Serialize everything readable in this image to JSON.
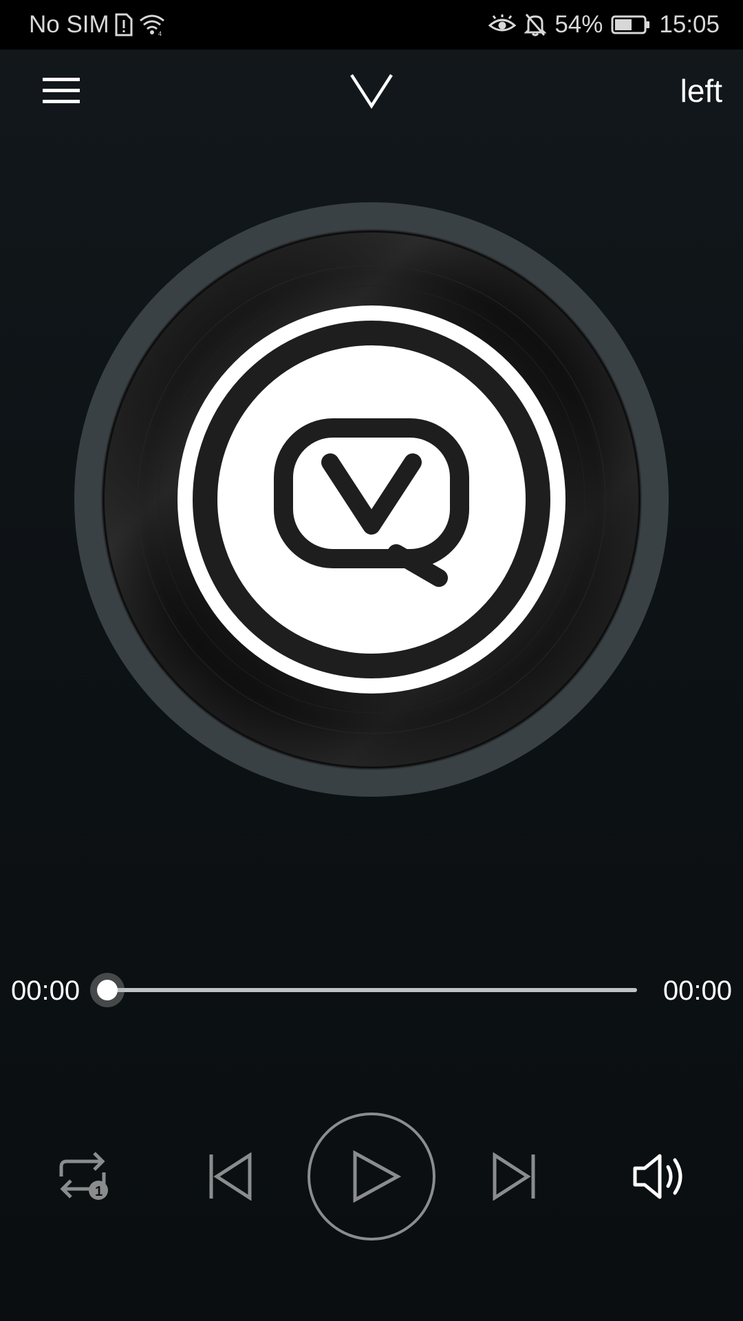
{
  "status_bar": {
    "carrier": "No SIM",
    "battery_percent": "54%",
    "time": "15:05",
    "icons": [
      "sim-alert-icon",
      "wifi-icon",
      "eye-comfort-icon",
      "notifications-off-icon",
      "battery-icon"
    ]
  },
  "app_bar": {
    "menu_icon": "hamburger-menu-icon",
    "collapse_icon": "chevron-down-icon",
    "channel_label": "left"
  },
  "player": {
    "artwork_icon": "vinyl-record-with-logo",
    "current_time": "00:00",
    "total_time": "00:00",
    "progress": 0
  },
  "controls": {
    "repeat_icon": "repeat-one-icon",
    "previous_icon": "skip-previous-icon",
    "play_icon": "play-icon",
    "next_icon": "skip-next-icon",
    "volume_icon": "volume-icon"
  },
  "colors": {
    "background": "#0b0f11",
    "status_bar": "#000000",
    "vinyl_rim": "#3a4145",
    "vinyl_body": "#141414",
    "label": "#ffffff",
    "logo": "#1e1e1e",
    "control_gray": "#8a8c8d"
  }
}
